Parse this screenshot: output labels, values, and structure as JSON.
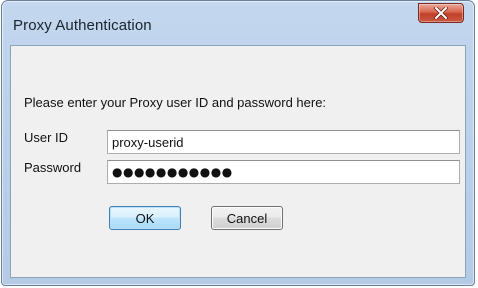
{
  "window": {
    "title": "Proxy Authentication"
  },
  "form": {
    "prompt": "Please enter your Proxy user ID and password here:",
    "user_id_label": "User ID",
    "user_id_value": "proxy-userid",
    "password_label": "Password",
    "password_value": "●●●●●●●●●●●"
  },
  "buttons": {
    "ok_label": "OK",
    "cancel_label": "Cancel"
  },
  "icons": {
    "close": "close-icon"
  },
  "colors": {
    "close_button": "#c95a42",
    "ok_button_border": "#3c7fb1",
    "window_frame": "#bcd2eb"
  }
}
